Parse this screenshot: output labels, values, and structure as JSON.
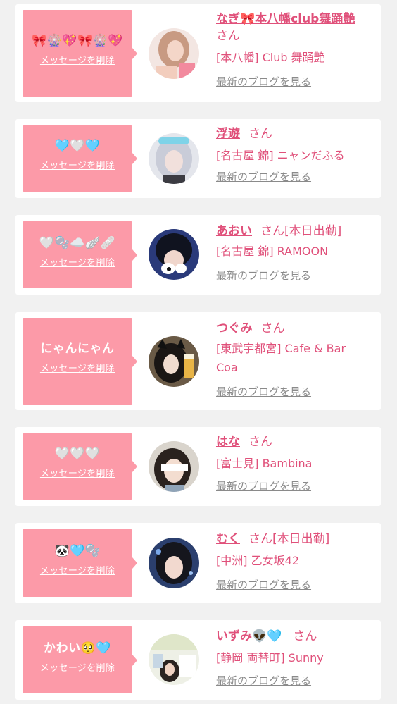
{
  "delete_label": "メッセージを削除",
  "san_label": "さん",
  "blog_label": "最新のブログを見る",
  "cards": [
    {
      "bubble_message": "🎀🎡💖🎀🎡💖",
      "name": "なぎ🎀本八幡club舞踊艶",
      "badge": "",
      "shop": "[本八幡] Club 舞踊艶"
    },
    {
      "bubble_message": "🩵🤍🩵",
      "name": "浮遊",
      "badge": "",
      "shop": "[名古屋 錦] ニャンだふる"
    },
    {
      "bubble_message": "🤍🫧☁️🪽🩹",
      "name": "あおい",
      "badge": "[本日出勤]",
      "shop": "[名古屋 錦] RAMOON"
    },
    {
      "bubble_message": "にゃんにゃん",
      "name": "つぐみ",
      "badge": "",
      "shop": "[東武宇都宮] Cafe & Bar Coa"
    },
    {
      "bubble_message": "🤍🤍🤍",
      "name": "はな",
      "badge": "",
      "shop": "[富士見] Bambina"
    },
    {
      "bubble_message": "🐼🩵🫧",
      "name": "むく",
      "badge": "[本日出勤]",
      "shop": "[中洲] 乙女坂42"
    },
    {
      "bubble_message": "かわい🥺🩵",
      "name": "いずみ👽🩵",
      "badge": "",
      "shop": "[静岡 両替町] Sunny"
    }
  ]
}
